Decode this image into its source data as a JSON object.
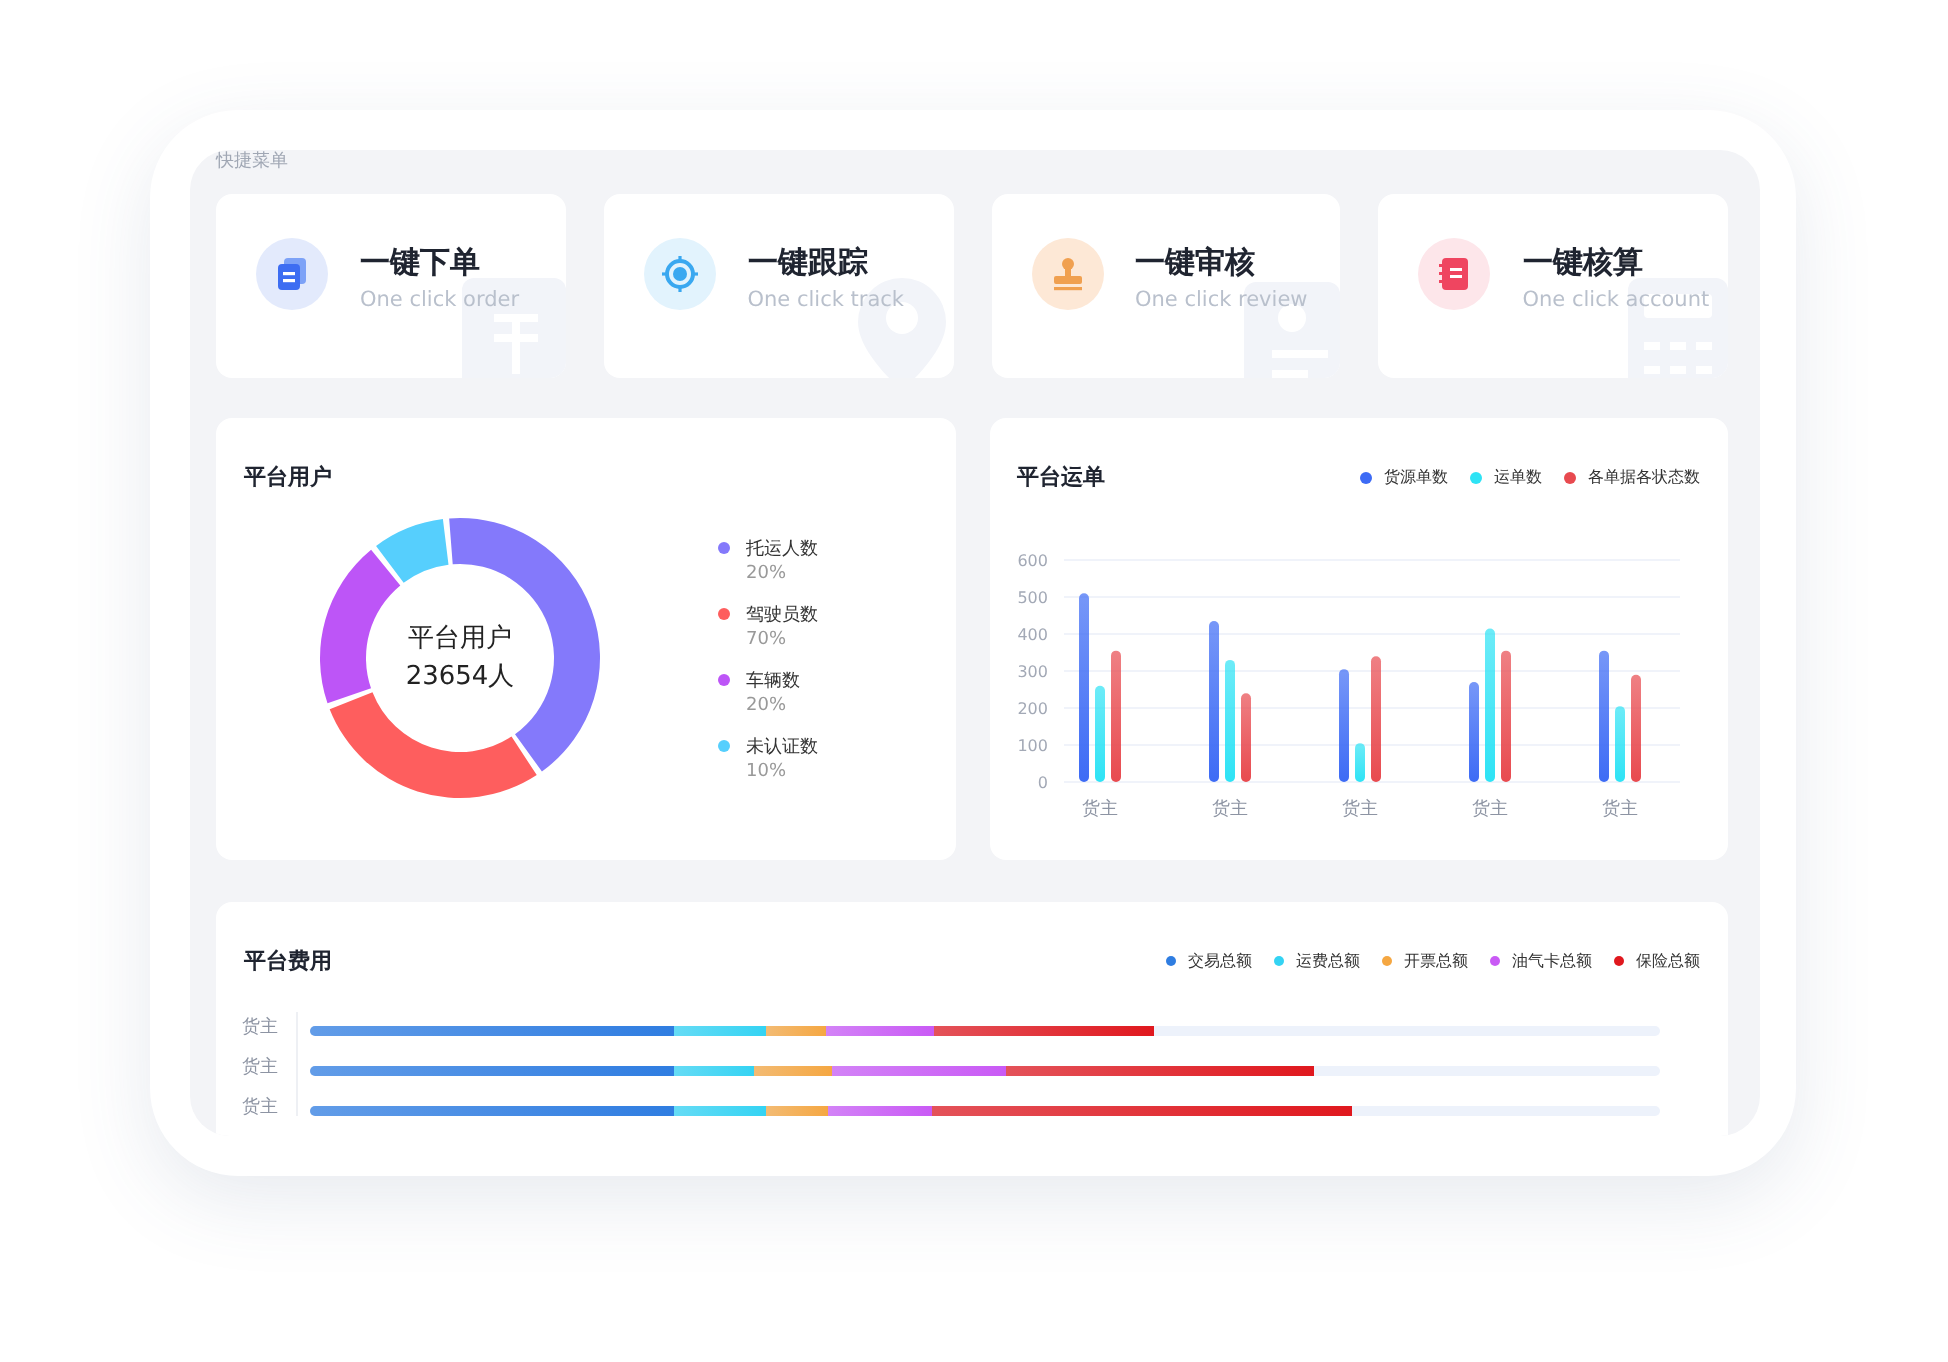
{
  "quick_menu": {
    "label": "快捷菜单",
    "items": [
      {
        "kind": "order",
        "title": "一键下单",
        "subtitle": "One click order"
      },
      {
        "kind": "track",
        "title": "一键跟踪",
        "subtitle": "One click track"
      },
      {
        "kind": "review",
        "title": "一键审核",
        "subtitle": "One click review"
      },
      {
        "kind": "account",
        "title": "一键核算",
        "subtitle": "One click account"
      }
    ]
  },
  "users": {
    "title": "平台用户",
    "center_label": "平台用户",
    "center_value": "23654人",
    "legend": [
      {
        "percent": "20%",
        "color": "#8479fb"
      },
      {
        "percent": "70%",
        "color": "#fe5e5e"
      },
      {
        "percent": "20%",
        "color": "#bd55f7"
      },
      {
        "percent": "10%",
        "color": "#56cffd"
      }
    ],
    "chart_data": {
      "type": "donut",
      "categories": [
        "托运人数",
        "驾驶员数",
        "车辆数",
        "未认证数"
      ],
      "values": [
        42,
        29,
        20,
        9
      ]
    }
  },
  "waybills": {
    "title": "平台运单",
    "chart_data": {
      "type": "bar",
      "grid": true,
      "categories": [
        "货主",
        "货主",
        "货主",
        "货主",
        "货主"
      ],
      "ylim": [
        0,
        600
      ],
      "yticks": [
        0,
        100,
        200,
        300,
        400,
        500,
        600
      ],
      "series": [
        {
          "name": "货源单数",
          "color": "#3d6bf5",
          "values": [
            510,
            435,
            305,
            270,
            355
          ]
        },
        {
          "name": "运单数",
          "color": "#2ee3f5",
          "values": [
            260,
            330,
            105,
            415,
            205
          ]
        },
        {
          "name": "各单据各状态数",
          "color": "#e84a4f",
          "values": [
            355,
            240,
            340,
            355,
            290
          ]
        }
      ]
    }
  },
  "fees": {
    "title": "平台费用",
    "categories": [
      "货主",
      "货主",
      "货主"
    ],
    "legend": [
      {
        "name": "交易总额",
        "color": "#2f7de1"
      },
      {
        "name": "运费总额",
        "color": "#34d3f3"
      },
      {
        "name": "开票总额",
        "color": "#f5a742"
      },
      {
        "name": "油气卡总额",
        "color": "#c95af5"
      },
      {
        "name": "保险总额",
        "color": "#e0181e"
      }
    ]
  }
}
